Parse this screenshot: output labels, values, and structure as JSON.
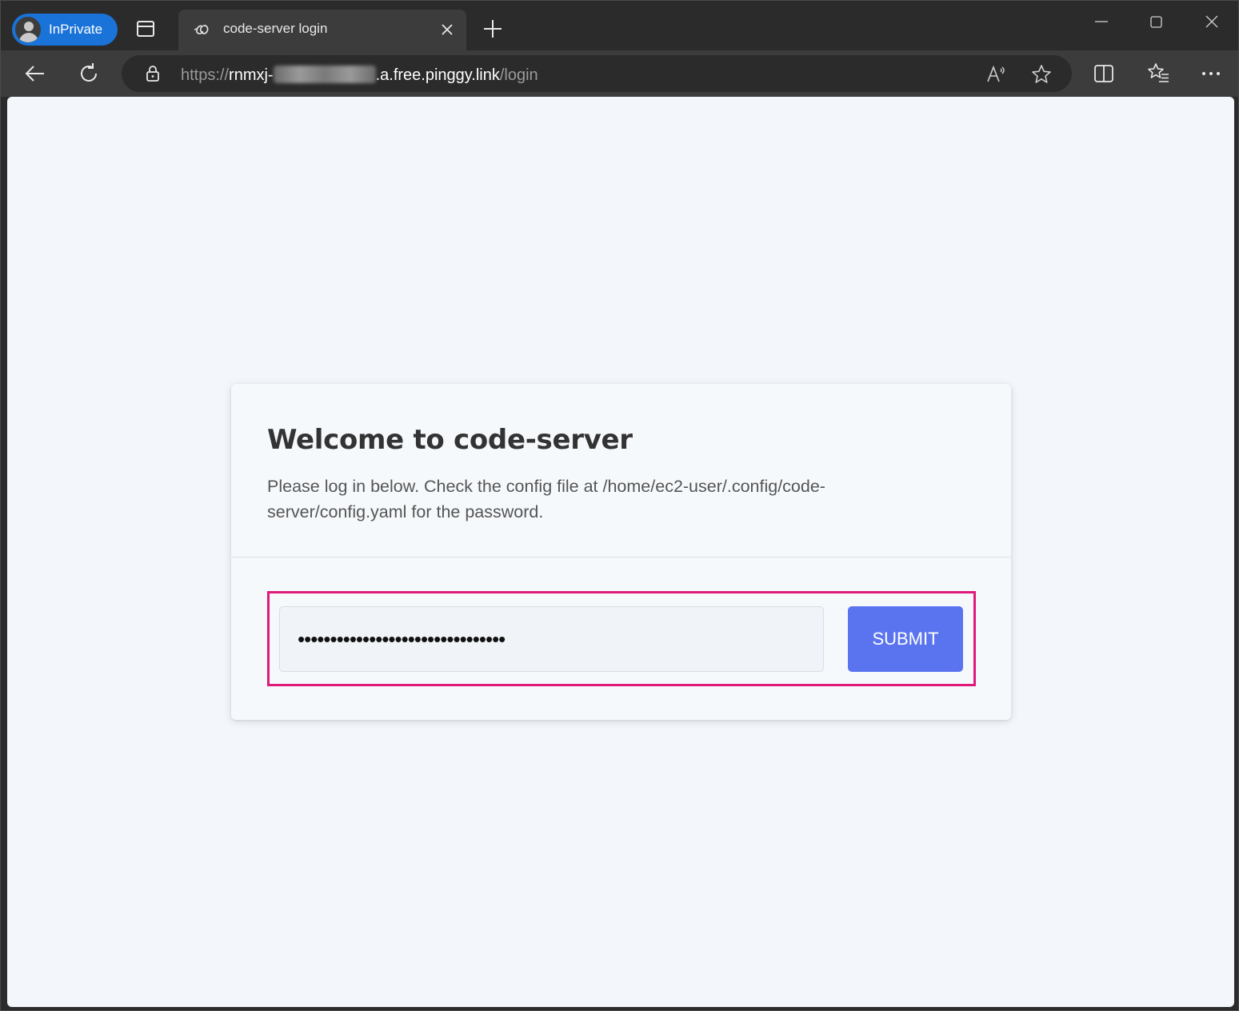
{
  "browser": {
    "inprivate_label": "InPrivate",
    "tab_title": "code-server login",
    "url": {
      "scheme": "https://",
      "host_prefix": "rnmxj-",
      "host_suffix": ".a.free.pinggy.link",
      "path": "/login"
    }
  },
  "login": {
    "heading": "Welcome to code-server",
    "description": "Please log in below. Check the config file at /home/ec2-user/.config/code-server/config.yaml for the password.",
    "password_masked": "••••••••••••••••••••••••••••••••",
    "submit_label": "SUBMIT"
  },
  "colors": {
    "accent": "#5a74f0",
    "highlight": "#e0197a",
    "inprivate": "#1a73d9"
  },
  "icons": [
    "profile-avatar-icon",
    "tab-actions-icon",
    "code-server-favicon",
    "close-icon",
    "plus-icon",
    "minimize-icon",
    "maximize-icon",
    "window-close-icon",
    "back-icon",
    "refresh-icon",
    "lock-icon",
    "read-aloud-icon",
    "star-icon",
    "split-screen-icon",
    "favorites-icon",
    "more-icon"
  ]
}
